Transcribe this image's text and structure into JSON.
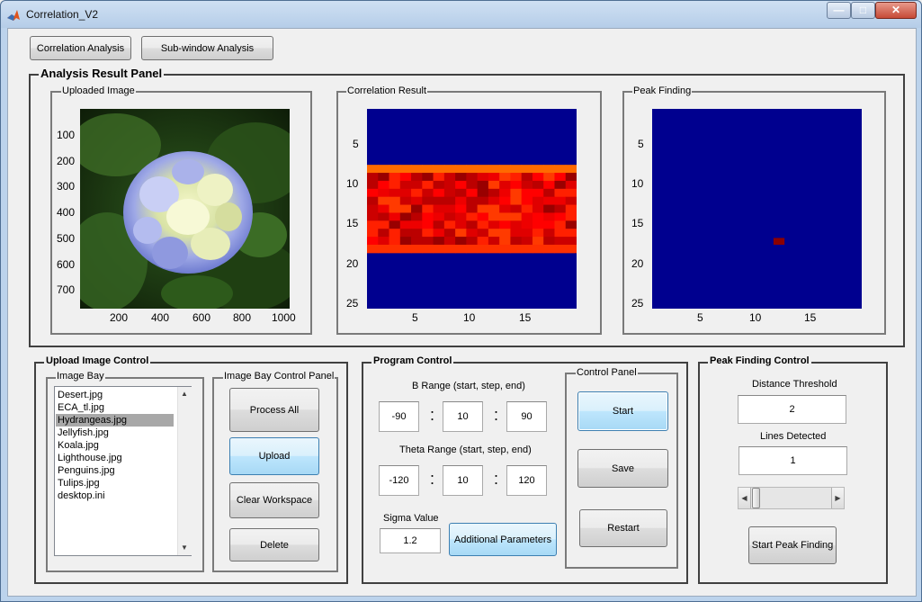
{
  "window": {
    "title": "Correlation_V2",
    "minimize": "—",
    "maximize": "□",
    "close": "✕"
  },
  "toolbar": {
    "correlation_label": "Correlation Analysis",
    "subwindow_label": "Sub-window Analysis"
  },
  "result_panel": {
    "title": "Analysis Result Panel",
    "uploaded": {
      "title": "Uploaded Image",
      "yticks": [
        "100",
        "200",
        "300",
        "400",
        "500",
        "600",
        "700"
      ],
      "xticks": [
        "200",
        "400",
        "600",
        "800",
        "1000"
      ]
    },
    "correlation": {
      "title": "Correlation Result",
      "yticks": [
        "5",
        "10",
        "15",
        "20",
        "25"
      ],
      "xticks": [
        "5",
        "10",
        "15"
      ]
    },
    "peak": {
      "title": "Peak Finding",
      "yticks": [
        "5",
        "10",
        "15",
        "20",
        "25"
      ],
      "xticks": [
        "5",
        "10",
        "15"
      ]
    }
  },
  "upload_control": {
    "title": "Upload Image Control",
    "bay_title": "Image Bay",
    "files": [
      "Desert.jpg",
      "ECA_tl.jpg",
      "Hydrangeas.jpg",
      "Jellyfish.jpg",
      "Koala.jpg",
      "Lighthouse.jpg",
      "Penguins.jpg",
      "Tulips.jpg",
      "desktop.ini"
    ],
    "selected_file": "Hydrangeas.jpg",
    "bay_control_title": "Image Bay Control Panel",
    "process_all_label": "Process All",
    "upload_label": "Upload",
    "clear_label": "Clear Workspace",
    "delete_label": "Delete"
  },
  "program_control": {
    "title": "Program Control",
    "b_range_label": "B Range (start, step, end)",
    "b_start": "-90",
    "b_step": "10",
    "b_end": "90",
    "theta_range_label": "Theta Range (start, step, end)",
    "theta_start": "-120",
    "theta_step": "10",
    "theta_end": "120",
    "sigma_label": "Sigma Value",
    "sigma_value": "1.2",
    "additional_label": "Additional Parameters",
    "colon": ":",
    "control_panel_title": "Control Panel",
    "start_label": "Start",
    "save_label": "Save",
    "restart_label": "Restart"
  },
  "peak_control": {
    "title": "Peak Finding Control",
    "distance_label": "Distance Threshold",
    "distance_value": "2",
    "lines_label": "Lines Detected",
    "lines_value": "1",
    "slider_position": 0.0,
    "start_label": "Start Peak Finding"
  },
  "colors": {
    "jet_blue": "#00008f",
    "band_red": "#ff0000",
    "band_dark": "#990000",
    "peak_marker": "#8b0000",
    "list_selection": "#a8a8a8"
  },
  "correlation_map": {
    "grid_cols": 19,
    "grid_rows": 25,
    "band_rows": [
      8,
      18
    ]
  },
  "peak_map": {
    "peak_col": 12,
    "peak_row": 17
  }
}
